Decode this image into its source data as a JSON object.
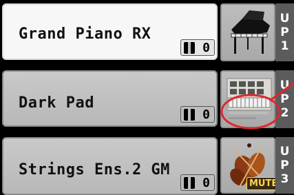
{
  "tracks": [
    {
      "name": "Grand Piano RX",
      "octave": "0",
      "label_letters": [
        "U",
        "P",
        "1"
      ],
      "icon": "grand-piano-icon",
      "state": "selected"
    },
    {
      "name": "Dark Pad",
      "octave": "0",
      "label_letters": [
        "U",
        "P",
        "2"
      ],
      "icon": "synth-pad-icon",
      "state": "normal"
    },
    {
      "name": "Strings Ens.2 GM",
      "octave": "0",
      "label_letters": [
        "U",
        "P",
        "3"
      ],
      "icon": "strings-icon",
      "state": "muted",
      "mute_label": "MUTE"
    }
  ],
  "colors": {
    "callout": "#e0262b",
    "selected_panel": "#f7f7f7",
    "normal_panel": "#c2c2c2",
    "label_bg": "#5b5b5b"
  }
}
